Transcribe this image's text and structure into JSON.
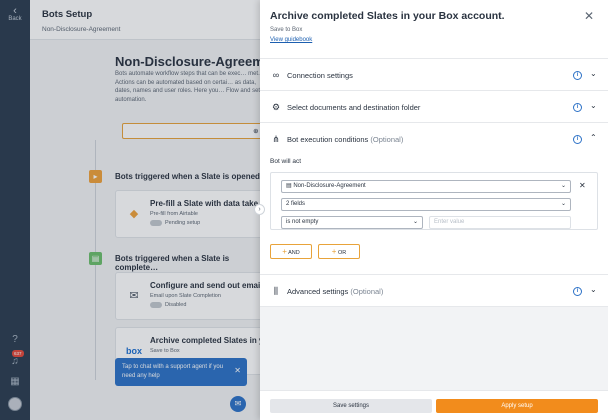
{
  "rail": {
    "back_label": "Back",
    "notification_count": "637"
  },
  "page": {
    "title": "Bots Setup",
    "subtitle": "Non-Disclosure-Agreement",
    "heading": "Non-Disclosure-Agreement",
    "description": "Bots automate workflow steps that can be exec… met. Actions can be automated based on certai… as data, dates, names and user roles. Here you… Flow and set automation.",
    "add_button_label": "Ad",
    "sections": [
      {
        "title": "Bots triggered when a Slate is opened",
        "cards": [
          {
            "title": "Pre-fill a Slate with data take…",
            "subtitle": "Pre-fill from Airtable",
            "status": "Pending setup"
          }
        ]
      },
      {
        "title": "Bots triggered when a Slate is complete…",
        "cards": [
          {
            "title": "Configure and send out email…",
            "subtitle": "Email upon Slate Completion",
            "status": "Disabled"
          },
          {
            "title": "Archive completed Slates in y…",
            "subtitle": "Save to Box",
            "status": ""
          }
        ]
      }
    ],
    "toast": "Tap to chat with a support agent if you need any help"
  },
  "panel": {
    "title": "Archive completed Slates in your Box account.",
    "subtitle": "Save to Box",
    "guide_link": "View guidebook",
    "sections": {
      "connection": {
        "label": "Connection settings",
        "optional": ""
      },
      "documents": {
        "label": "Select documents and destination folder",
        "optional": ""
      },
      "execution": {
        "label": "Bot execution conditions",
        "optional": "(Optional)"
      },
      "advanced": {
        "label": "Advanced settings",
        "optional": "(Optional)"
      }
    },
    "execution": {
      "bot_will_act": "Bot will act",
      "document_select": "Non-Disclosure-Agreement",
      "field_select": "2 fields",
      "operator_select": "is not empty",
      "value_placeholder": "Enter value",
      "and_label": "AND",
      "or_label": "OR"
    },
    "footer": {
      "save_label": "Save settings",
      "apply_label": "Apply setup"
    }
  },
  "colors": {
    "rail": "#2b3c50",
    "accent_orange": "#f28c1c",
    "link_blue": "#1c5fb0",
    "info_blue": "#2d72c7"
  }
}
